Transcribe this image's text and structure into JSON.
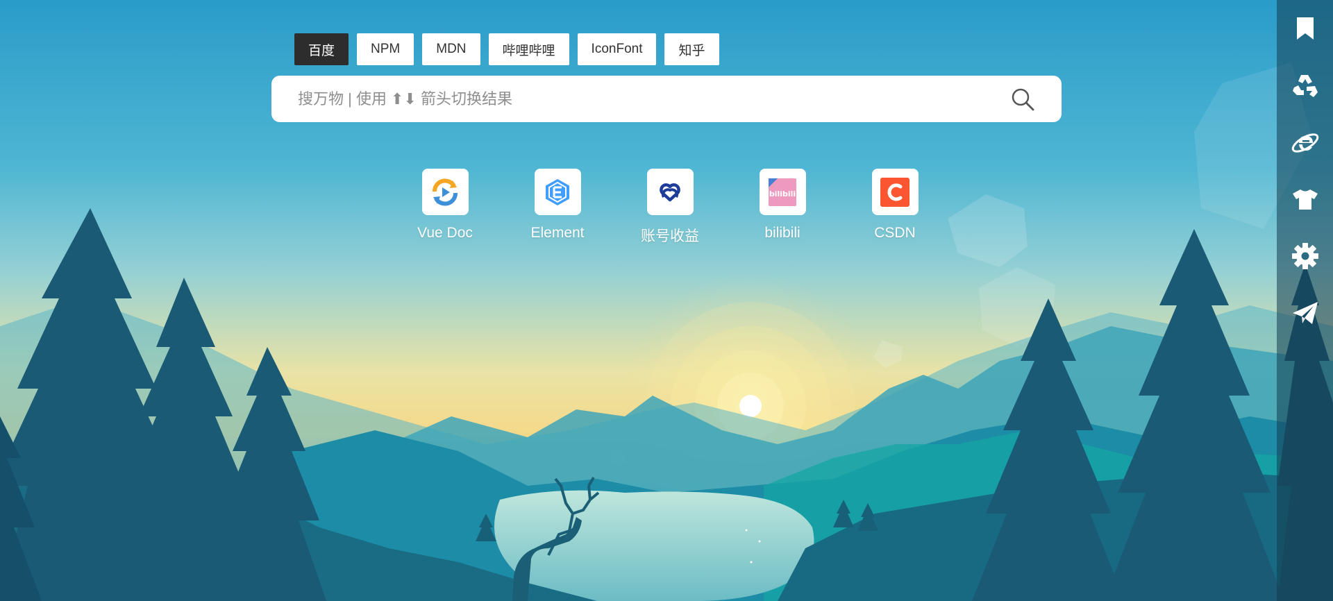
{
  "engines": [
    {
      "label": "百度",
      "active": true
    },
    {
      "label": "NPM",
      "active": false
    },
    {
      "label": "MDN",
      "active": false
    },
    {
      "label": "哔哩哔哩",
      "active": false
    },
    {
      "label": "IconFont",
      "active": false
    },
    {
      "label": "知乎",
      "active": false
    }
  ],
  "search": {
    "placeholder": "搜万物 | 使用 ⬆⬇ 箭头切换结果",
    "icon": "search-icon"
  },
  "shortcuts": [
    {
      "label": "Vue Doc",
      "icon": "vue-doc-icon"
    },
    {
      "label": "Element",
      "icon": "element-icon"
    },
    {
      "label": "账号收益",
      "icon": "account-earnings-icon"
    },
    {
      "label": "bilibili",
      "icon": "bilibili-icon"
    },
    {
      "label": "CSDN",
      "icon": "csdn-icon"
    }
  ],
  "sidebar": {
    "items": [
      {
        "icon": "bookmark-icon"
      },
      {
        "icon": "recycle-icon"
      },
      {
        "icon": "ie-browser-icon"
      },
      {
        "icon": "tshirt-icon"
      },
      {
        "icon": "gear-icon"
      },
      {
        "icon": "paper-plane-icon"
      }
    ]
  },
  "colors": {
    "sky_top": "#2a9cc9",
    "sky_mid": "#8fd0d6",
    "horizon": "#f5d98a",
    "engine_active_bg": "#2d2d2d",
    "sidebar_bg": "#1d4a5e",
    "csdn_red": "#fc5531",
    "element_blue": "#409eff"
  }
}
